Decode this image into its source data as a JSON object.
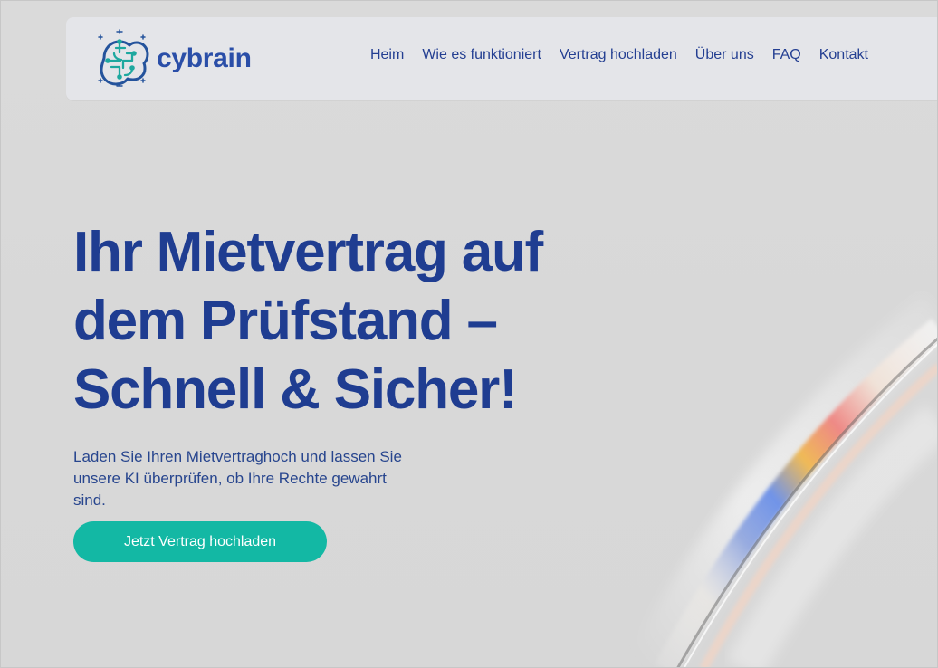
{
  "brand": {
    "name": "cybrain",
    "logo_icon": "brain-circuit-icon",
    "colors": {
      "primary_text": "#1f3d91",
      "accent": "#13b8a4",
      "nav_bg": "#e4e5e9"
    }
  },
  "nav": {
    "items": [
      {
        "label": "Heim"
      },
      {
        "label": "Wie es funktioniert"
      },
      {
        "label": "Vertrag hochladen"
      },
      {
        "label": "Über uns"
      },
      {
        "label": "FAQ"
      },
      {
        "label": "Kontakt"
      }
    ]
  },
  "hero": {
    "title_lines": [
      "Ihr Mietvertrag auf",
      "dem Prüfstand –",
      "Schnell & Sicher!"
    ],
    "subtitle": "Laden Sie Ihren Mietvertraghoch und lassen Sie unsere KI überprüfen, ob Ihre Rechte gewahrt sind.",
    "cta_label": "Jetzt Vertrag hochladen"
  }
}
